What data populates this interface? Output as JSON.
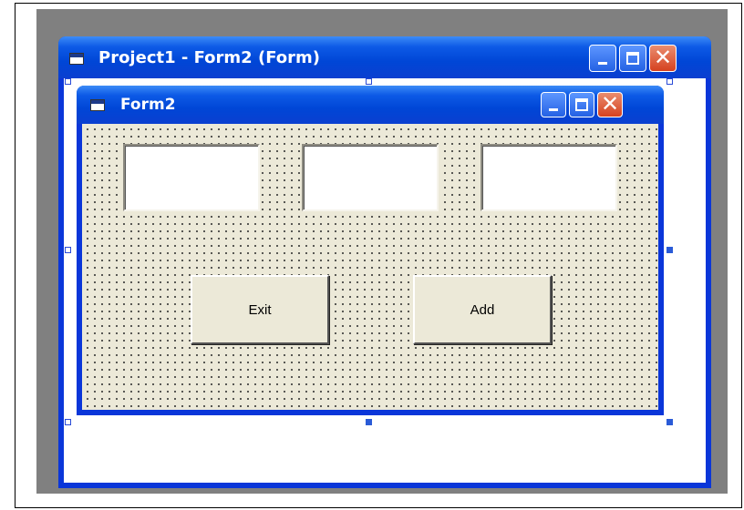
{
  "outer_window": {
    "title": "Project1 - Form2 (Form)",
    "icon": "form-icon",
    "buttons": {
      "minimize": "minimize-icon",
      "maximize": "maximize-icon",
      "close": "close-icon"
    }
  },
  "form_window": {
    "title": "Form2",
    "icon": "form-icon",
    "buttons": {
      "minimize": "minimize-icon",
      "maximize": "maximize-icon",
      "close": "close-icon"
    },
    "textboxes": [
      "",
      "",
      ""
    ],
    "command_buttons": {
      "exit": "Exit",
      "add": "Add"
    }
  },
  "colors": {
    "title_bar": "#0046d6",
    "form_background": "#ece9d8",
    "close_button": "#d5411f",
    "workspace": "#808080"
  }
}
